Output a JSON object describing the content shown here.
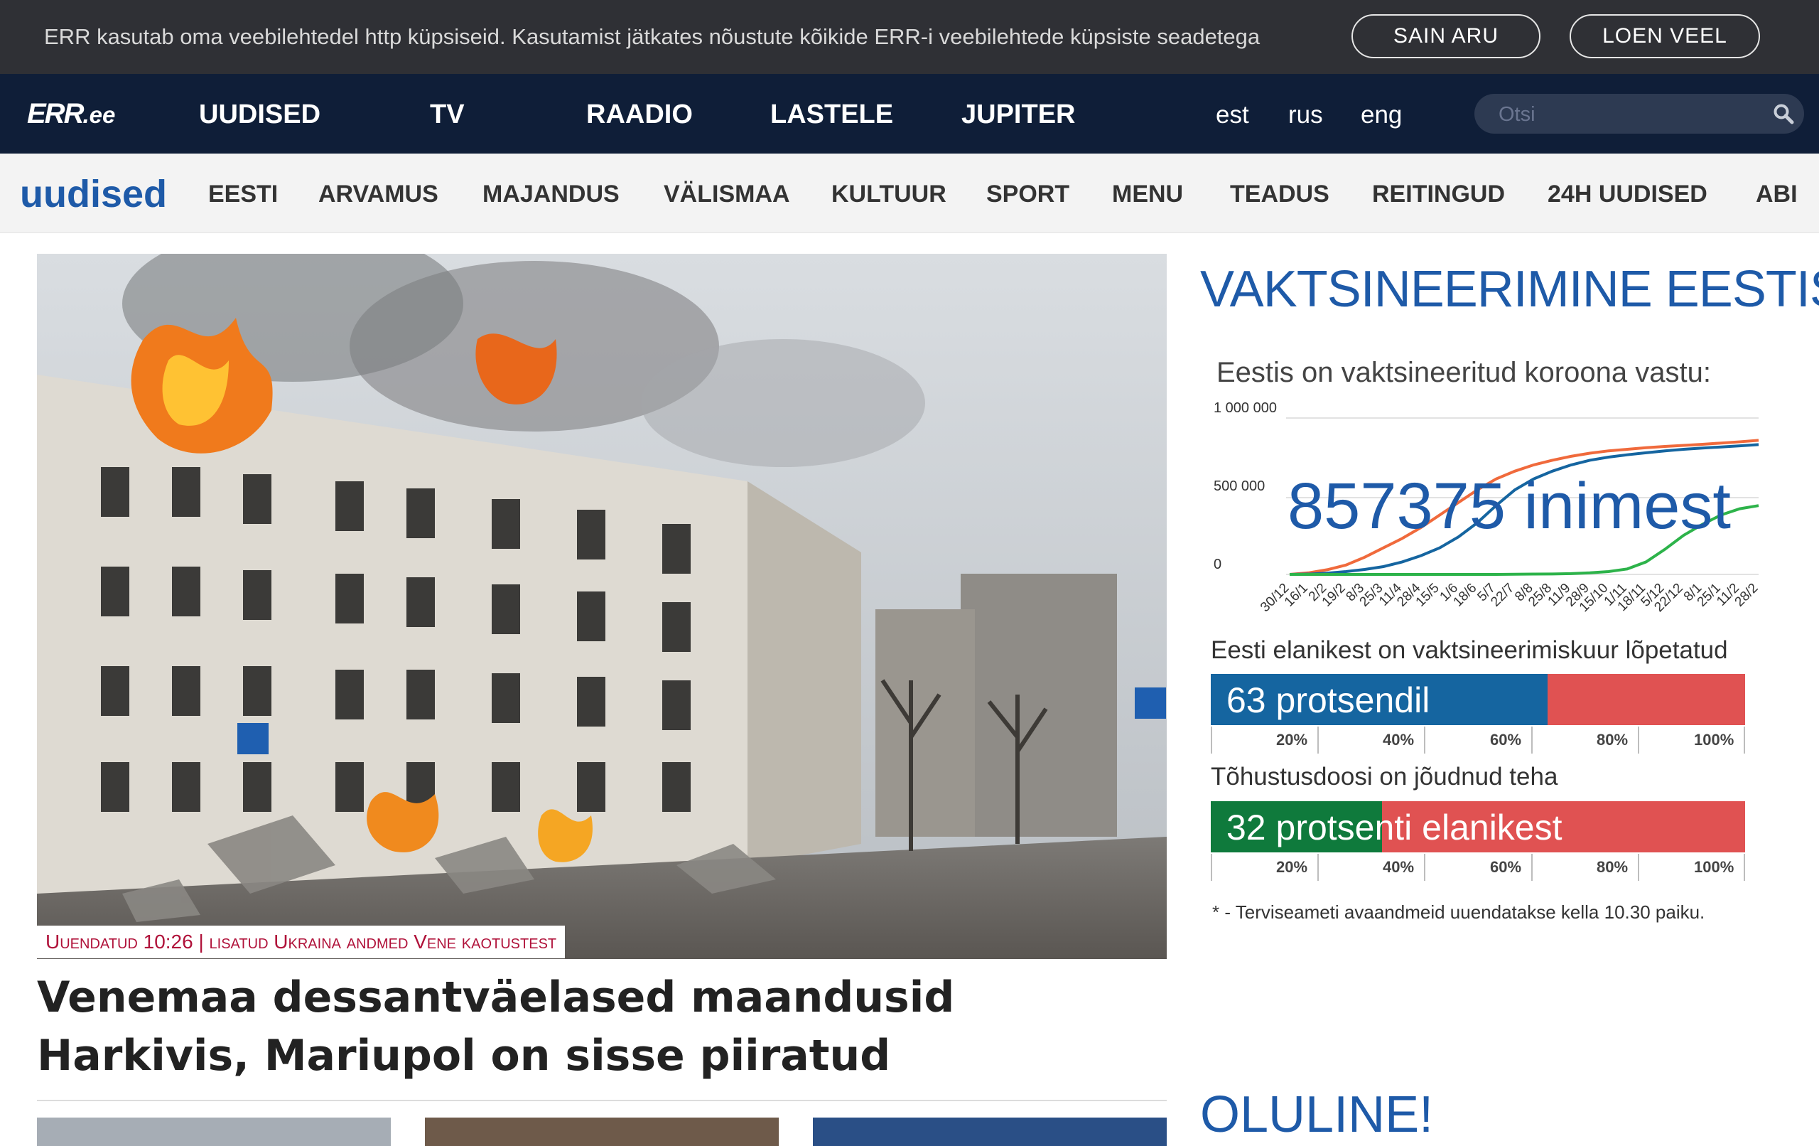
{
  "cookie": {
    "text": "ERR kasutab oma veebilehtedel http küpsiseid. Kasutamist jätkates nõustute kõikide ERR-i veebilehtede küpsiste seadetega",
    "accept_label": "SAIN ARU",
    "more_label": "LOEN VEEL"
  },
  "nav": {
    "logo": "ERR",
    "logo_suffix": ".ee",
    "items": [
      "UUDISED",
      "TV",
      "RAADIO",
      "LASTELE",
      "JUPITER"
    ],
    "languages": [
      "est",
      "rus",
      "eng"
    ],
    "search_placeholder": "Otsi"
  },
  "subnav": {
    "brand": "uudised",
    "items": [
      "EESTI",
      "ARVAMUS",
      "MAJANDUS",
      "VÄLISMAA",
      "KULTUUR",
      "SPORT",
      "MENU",
      "TEADUS",
      "REITINGUD",
      "24H UUDISED",
      "ABI"
    ]
  },
  "hero": {
    "caption": "Uuendatud 10:26 | lisatud Ukraina andmed Vene kaotustest",
    "headline": "Venemaa dessantväelased maandusid Harkivis, Mariupol on sisse piiratud"
  },
  "sidebar": {
    "title": "VAKTSINEERIMINE EESTIS",
    "widget_heading": "Eestis on vaktsineeritud koroona vastu:",
    "count_text": "857375 inimest",
    "bar1_label": "Eesti elanikest on vaktsineerimiskuur lõpetatud",
    "bar1_text": "63  protsendil",
    "bar1_value": 63,
    "bar2_label": "Tõhustusdoosi on jõudnud teha",
    "bar2_text": "32  protsenti elanikest",
    "bar2_value": 32,
    "bar_ticks": [
      "20%",
      "40%",
      "60%",
      "80%",
      "100%"
    ],
    "note": "* - Terviseameti avaandmeid uuendatakse kella 10.30 paiku.",
    "title2": "OLULINE!"
  },
  "colors": {
    "accent": "#1e5aa8",
    "bar_blue": "#1565a0",
    "bar_green": "#0f7a3c",
    "bar_red": "#e05252",
    "line_orange": "#f06a3c",
    "line_blue": "#1565a0",
    "line_green": "#2db34a"
  },
  "chart_data": {
    "type": "line",
    "x": [
      "30/12",
      "16/1",
      "2/2",
      "19/2",
      "8/3",
      "25/3",
      "11/4",
      "28/4",
      "15/5",
      "1/6",
      "18/6",
      "5/7",
      "22/7",
      "8/8",
      "25/8",
      "11/9",
      "28/9",
      "15/10",
      "1/11",
      "18/11",
      "5/12",
      "22/12",
      "8/1",
      "25/1",
      "11/2",
      "28/2"
    ],
    "yticks": [
      "1 000 000",
      "500 000",
      "0"
    ],
    "ylim": [
      0,
      1000000
    ],
    "series": [
      {
        "color": "#f06a3c",
        "values": [
          0,
          10000,
          30000,
          60000,
          110000,
          170000,
          230000,
          300000,
          380000,
          460000,
          540000,
          610000,
          660000,
          700000,
          730000,
          755000,
          775000,
          790000,
          800000,
          810000,
          818000,
          825000,
          832000,
          840000,
          848000,
          857375
        ]
      },
      {
        "color": "#1565a0",
        "values": [
          0,
          2000,
          8000,
          18000,
          32000,
          50000,
          80000,
          120000,
          170000,
          240000,
          330000,
          440000,
          540000,
          610000,
          660000,
          700000,
          730000,
          750000,
          765000,
          778000,
          790000,
          800000,
          808000,
          815000,
          822000,
          830000
        ]
      },
      {
        "color": "#2db34a",
        "values": [
          0,
          0,
          0,
          0,
          0,
          0,
          0,
          0,
          0,
          0,
          0,
          0,
          1000,
          2000,
          3000,
          5000,
          10000,
          18000,
          35000,
          80000,
          160000,
          250000,
          320000,
          380000,
          420000,
          440000
        ]
      }
    ]
  }
}
